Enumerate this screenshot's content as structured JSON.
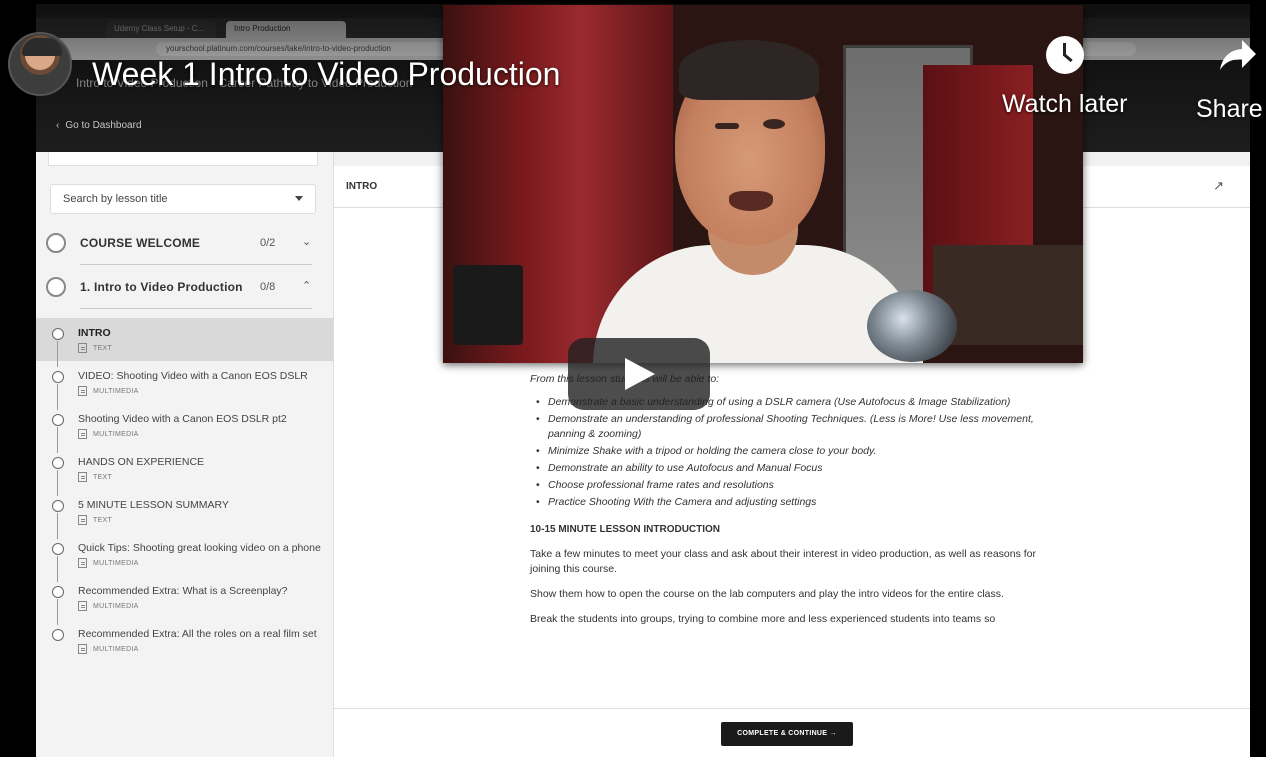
{
  "browser": {
    "tabs": [
      "Udemy Class Setup - C...",
      "Intro Production"
    ],
    "url": "yourschool.platinum.com/courses/take/intro-to-video-production"
  },
  "course": {
    "title": "Intro to Video Production - Career Pathway to Video Production",
    "back_label": "Go to Dashboard"
  },
  "sidebar": {
    "search_placeholder": "Search by lesson title",
    "chapters": [
      {
        "title": "COURSE WELCOME",
        "count": "0/2",
        "toggle": "⌄"
      },
      {
        "title": "1. Intro to Video Production",
        "count": "0/8",
        "toggle": "⌃"
      }
    ],
    "lessons": [
      {
        "title": "INTRO",
        "type": "TEXT",
        "active": true
      },
      {
        "title": "VIDEO: Shooting Video with a Canon EOS DSLR",
        "type": "MULTIMEDIA"
      },
      {
        "title": "Shooting Video with a Canon EOS DSLR pt2",
        "type": "MULTIMEDIA"
      },
      {
        "title": "HANDS ON EXPERIENCE",
        "type": "TEXT"
      },
      {
        "title": "5 MINUTE LESSON SUMMARY",
        "type": "TEXT"
      },
      {
        "title": "Quick Tips: Shooting great looking video on a phone",
        "type": "MULTIMEDIA"
      },
      {
        "title": "Recommended Extra: What is a Screenplay?",
        "type": "MULTIMEDIA"
      },
      {
        "title": "Recommended Extra: All the roles on a real film set",
        "type": "MULTIMEDIA"
      }
    ]
  },
  "main": {
    "lesson_title": "INTRO",
    "expand_icon": "↗",
    "objectives_intro": "From this lesson students will be able to:",
    "objectives": [
      "Demonstrate a basic understanding of using a DSLR camera (Use Autofocus & Image Stabilization)",
      "Demonstrate an understanding of professional Shooting Techniques. (Less is More! Use less movement, panning & zooming)",
      "Minimize Shake with a tripod or holding the camera close to your body.",
      "Demonstrate an ability to use Autofocus and Manual Focus",
      "Choose professional frame rates and resolutions",
      "Practice Shooting With the Camera and adjusting settings"
    ],
    "section_heading": "10-15 MINUTE LESSON INTRODUCTION",
    "paragraphs": [
      "Take a few minutes to meet your class and ask about their interest in video production, as well as reasons for joining this course.",
      "Show them how to open the course on the lab computers and play the intro videos for the entire class.",
      "Break the students into groups, trying to combine more and less experienced students into teams so"
    ],
    "complete_button": "COMPLETE & CONTINUE →"
  },
  "youtube": {
    "title": "Week 1 Intro to Video Production",
    "watch_later": "Watch later",
    "share": "Share"
  }
}
